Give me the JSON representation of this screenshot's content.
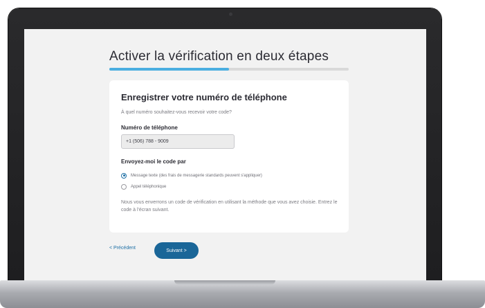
{
  "page": {
    "title": "Activer la vérification en deux étapes",
    "progress_fraction": 0.5
  },
  "card": {
    "title": "Enregistrer votre numéro de téléphone",
    "question": "À quel numéro souhaitez-vous recevoir votre code?",
    "phone_label": "Numéro de téléphone",
    "phone_value": "+1 (506) 788 - 9009",
    "send_label": "Envoyez-moi le code par",
    "options": [
      {
        "label": "Message texte (des frais de messagerie standards peuvent s'appliquer)",
        "selected": true
      },
      {
        "label": "Appel téléphonique",
        "selected": false
      }
    ],
    "info": "Nous vous enverrons un code de vérification en utilisant la méthode que vous avez choisie. Entrez le code à l'écran suivant."
  },
  "nav": {
    "prev_label": "< Précédent",
    "next_label": "Suivant >"
  },
  "colors": {
    "accent": "#1a6698",
    "progress": "#4aaee0",
    "background": "#f2f2f2",
    "card": "#ffffff"
  }
}
